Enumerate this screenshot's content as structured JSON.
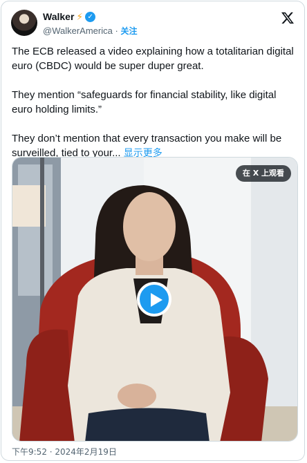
{
  "author": {
    "name": "Walker",
    "name_emoji": "⚡",
    "handle": "@WalkerAmerica",
    "separator": "·",
    "follow_label": "关注"
  },
  "tweet": {
    "paragraphs": [
      "The ECB released a video explaining how a totalitarian digital euro (CBDC) would be super duper great.",
      "They mention “safeguards for financial stability, like digital euro holding limits.”",
      "They don’t mention that every transaction you make will be surveilled, tied to your..."
    ],
    "show_more": "显示更多"
  },
  "media": {
    "watch_on_x": "在 X 上观看"
  },
  "timestamp": "下午9:52 · 2024年2月19日",
  "colors": {
    "accent": "#1d9bf0",
    "text": "#0f1419",
    "secondary": "#536471",
    "chair": "#a3281f"
  },
  "icons": {
    "verified": "verified-badge-icon",
    "x_logo": "x-logo-icon",
    "play": "play-icon"
  }
}
